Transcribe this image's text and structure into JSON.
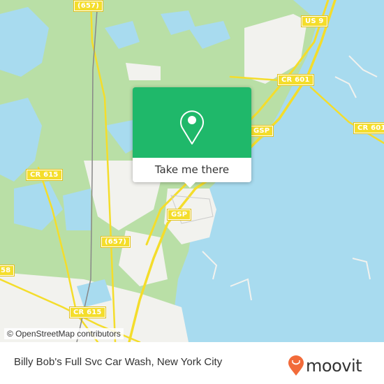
{
  "map": {
    "attribution": "© OpenStreetMap contributors",
    "road_labels": [
      {
        "id": "657-top",
        "text": "(657)"
      },
      {
        "id": "us9",
        "text": "US 9"
      },
      {
        "id": "cr601-a",
        "text": "CR 601"
      },
      {
        "id": "cr601-b",
        "text": "CR 601"
      },
      {
        "id": "gsp-a",
        "text": "GSP"
      },
      {
        "id": "gsp-b",
        "text": "GSP"
      },
      {
        "id": "cr615-a",
        "text": "CR 615"
      },
      {
        "id": "cr615-b",
        "text": "CR 615"
      },
      {
        "id": "657-mid",
        "text": "(657)"
      },
      {
        "id": "58-edge",
        "text": "58"
      }
    ],
    "colors": {
      "water": "#a8dbef",
      "land": "#b9dfa6",
      "urban": "#f2f2ee",
      "road": "#f4dd2b",
      "popup": "#1fb86a",
      "moovit": "#f26b3a"
    }
  },
  "popup": {
    "icon": "map-pin-icon",
    "action_label": "Take me there"
  },
  "footer": {
    "place_title": "Billy Bob's Full Svc Car Wash, New York City",
    "brand": "moovit"
  }
}
